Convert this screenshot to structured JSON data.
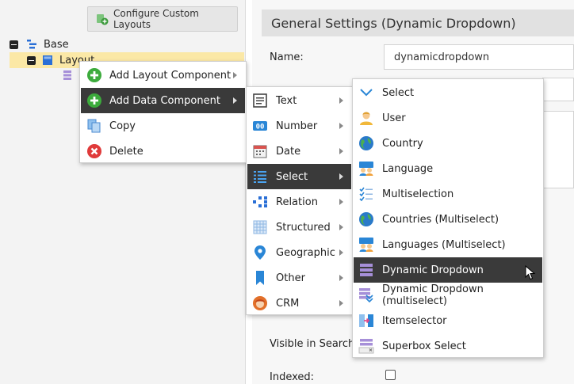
{
  "left": {
    "configure_btn": "Configure Custom Layouts",
    "tree": {
      "base": "Base",
      "layout": "Layout"
    }
  },
  "right": {
    "header": "General Settings (Dynamic Dropdown)",
    "name_label": "Name:",
    "name_value": "dynamicdropdown",
    "visible_label": "Visible in Search R",
    "indexed_label": "Indexed:"
  },
  "context_menu": {
    "items": [
      {
        "label": "Add Layout Component",
        "icon": "plus-circle-icon"
      },
      {
        "label": "Add Data Component",
        "icon": "plus-circle-icon"
      },
      {
        "label": "Copy",
        "icon": "copy-icon"
      },
      {
        "label": "Delete",
        "icon": "delete-icon"
      }
    ]
  },
  "data_menu": {
    "items": [
      {
        "label": "Text",
        "icon": "text-icon"
      },
      {
        "label": "Number",
        "icon": "number-icon"
      },
      {
        "label": "Date",
        "icon": "calendar-icon"
      },
      {
        "label": "Select",
        "icon": "list-icon"
      },
      {
        "label": "Relation",
        "icon": "relation-icon"
      },
      {
        "label": "Structured",
        "icon": "grid-icon"
      },
      {
        "label": "Geographic",
        "icon": "map-pin-icon"
      },
      {
        "label": "Other",
        "icon": "bookmark-icon"
      },
      {
        "label": "CRM",
        "icon": "crm-person-icon"
      }
    ]
  },
  "select_menu": {
    "items": [
      {
        "label": "Select",
        "icon": "chevron-down-icon"
      },
      {
        "label": "User",
        "icon": "user-icon"
      },
      {
        "label": "Country",
        "icon": "globe-icon"
      },
      {
        "label": "Language",
        "icon": "language-icon"
      },
      {
        "label": "Multiselection",
        "icon": "checklist-icon"
      },
      {
        "label": "Countries (Multiselect)",
        "icon": "globe-icon"
      },
      {
        "label": "Languages (Multiselect)",
        "icon": "language-icon"
      },
      {
        "label": "Dynamic Dropdown",
        "icon": "dynamic-dropdown-icon"
      },
      {
        "label": "Dynamic Dropdown (multiselect)",
        "icon": "dynamic-dropdown-multi-icon"
      },
      {
        "label": "Itemselector",
        "icon": "itemselector-icon"
      },
      {
        "label": "Superbox Select",
        "icon": "superbox-icon"
      }
    ]
  }
}
